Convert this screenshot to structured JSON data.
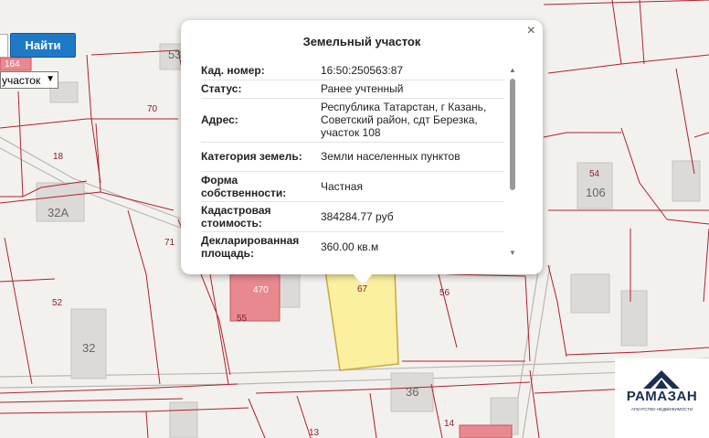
{
  "search": {
    "find_label": "Найти",
    "field_value": ""
  },
  "type_select": {
    "value": "участок"
  },
  "map": {
    "plot_numbers": [
      "164",
      "53",
      "70",
      "18",
      "32А",
      "71",
      "52",
      "32",
      "470",
      "55",
      "67",
      "56",
      "54",
      "106",
      "36",
      "13",
      "14"
    ],
    "selected_plot": "67"
  },
  "popup": {
    "title": "Земельный участок",
    "close_symbol": "×",
    "rows": [
      {
        "key": "Кад. номер:",
        "value": "16:50:250563:87"
      },
      {
        "key": "Статус:",
        "value": "Ранее учтенный"
      },
      {
        "key": "Адрес:",
        "value": "Республика Татарстан, г Казань, Советский район, сдт Березка, участок 108"
      },
      {
        "key": "Категория земель:",
        "value": "Земли населенных пунктов"
      },
      {
        "key": "Форма собственности:",
        "value": "Частная"
      },
      {
        "key": "Кадастровая стоимость:",
        "value": "384284.77 руб"
      },
      {
        "key": "Декларированная площадь:",
        "value": "360.00 кв.м"
      }
    ],
    "scroll_up_icon": "▲",
    "scroll_down_icon": "▼"
  },
  "logo": {
    "name": "РАМАЗАН",
    "tagline": "АГЕНТСТВО НЕДВИЖИМОСТИ"
  },
  "colors": {
    "plot_border": "#b3202c",
    "selected_plot_fill": "#fbefa0",
    "button": "#1f7ac6",
    "building_red": "#e8898f"
  }
}
